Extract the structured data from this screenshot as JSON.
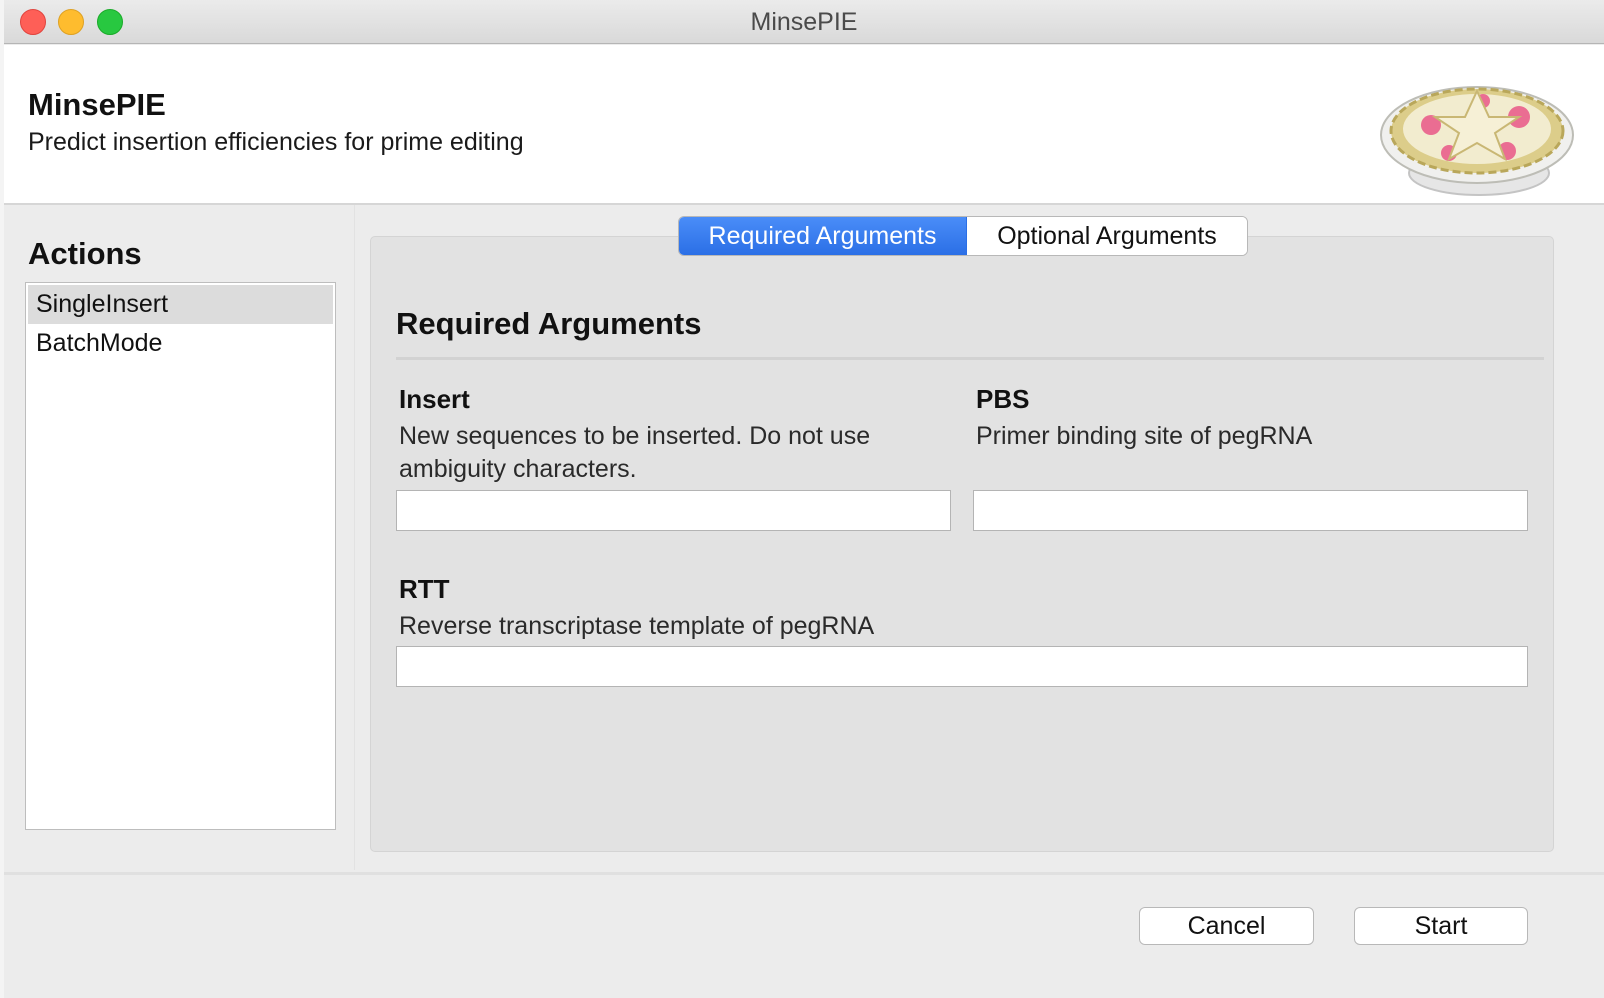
{
  "window": {
    "title": "MinsePIE"
  },
  "header": {
    "app_name": "MinsePIE",
    "description": "Predict insertion efficiencies for prime editing"
  },
  "actions": {
    "title": "Actions",
    "items": [
      {
        "label": "SingleInsert",
        "selected": true
      },
      {
        "label": "BatchMode",
        "selected": false
      }
    ]
  },
  "tabs": [
    {
      "label": "Required Arguments",
      "active": true
    },
    {
      "label": "Optional Arguments",
      "active": false
    }
  ],
  "section": {
    "title": "Required Arguments",
    "fields": {
      "insert": {
        "label": "Insert",
        "help": "New sequences to be inserted. Do not use ambiguity characters.",
        "value": ""
      },
      "pbs": {
        "label": "PBS",
        "help": "Primer binding site of pegRNA",
        "value": ""
      },
      "rtt": {
        "label": "RTT",
        "help": "Reverse transcriptase template of pegRNA",
        "value": ""
      }
    }
  },
  "buttons": {
    "cancel": "Cancel",
    "start": "Start"
  },
  "colors": {
    "tab_active": "#2b6fe6",
    "close": "#fe5f57",
    "minimize": "#febc2e",
    "zoom": "#28c840"
  },
  "icons": {
    "logo": "pie-logo"
  }
}
